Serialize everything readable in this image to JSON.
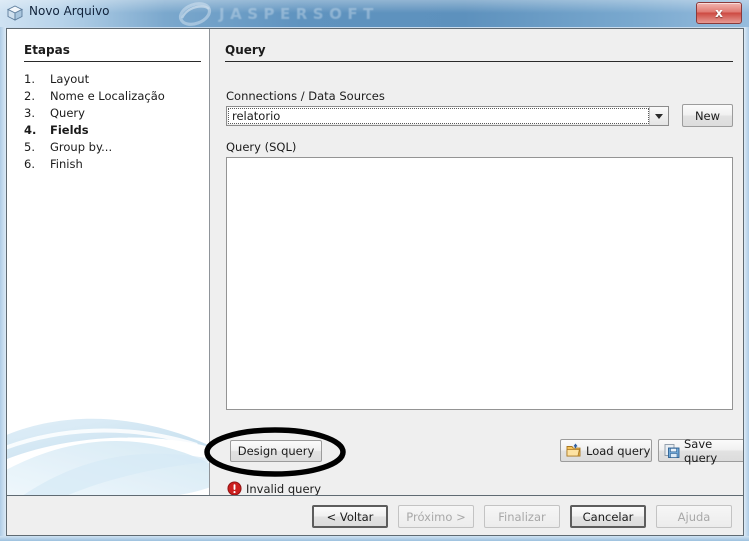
{
  "window": {
    "title": "Novo Arquivo",
    "icon": "cube-icon",
    "brand": "JASPERSOFT",
    "close_label": "x"
  },
  "steps_panel": {
    "heading": "Etapas",
    "items": [
      {
        "num": "1.",
        "label": "Layout",
        "active": false
      },
      {
        "num": "2.",
        "label": "Nome e Localização",
        "active": false
      },
      {
        "num": "3.",
        "label": "Query",
        "active": false
      },
      {
        "num": "4.",
        "label": "Fields",
        "active": true
      },
      {
        "num": "5.",
        "label": "Group by...",
        "active": false
      },
      {
        "num": "6.",
        "label": "Finish",
        "active": false
      }
    ]
  },
  "content": {
    "heading": "Query",
    "connections_label": "Connections / Data Sources",
    "connection_value": "relatorio",
    "new_button": "New",
    "query_label": "Query (SQL)",
    "query_value": "",
    "query_placeholder": "",
    "design_query_button": "Design query",
    "load_query_button": "Load query",
    "save_query_button": "Save query",
    "status_text": "Invalid query",
    "status_icon": "error-icon"
  },
  "footer": {
    "buttons": [
      {
        "label": "< Voltar",
        "enabled": true
      },
      {
        "label": "Próximo >",
        "enabled": false
      },
      {
        "label": "Finalizar",
        "enabled": false
      },
      {
        "label": "Cancelar",
        "enabled": true
      },
      {
        "label": "Ajuda",
        "enabled": false
      }
    ]
  },
  "colors": {
    "titlebar_blue": "#5d91bd",
    "close_red": "#cd4a42",
    "panel_grey": "#efefef",
    "error_red": "#cc1f1f",
    "annotation_black": "#000000"
  }
}
